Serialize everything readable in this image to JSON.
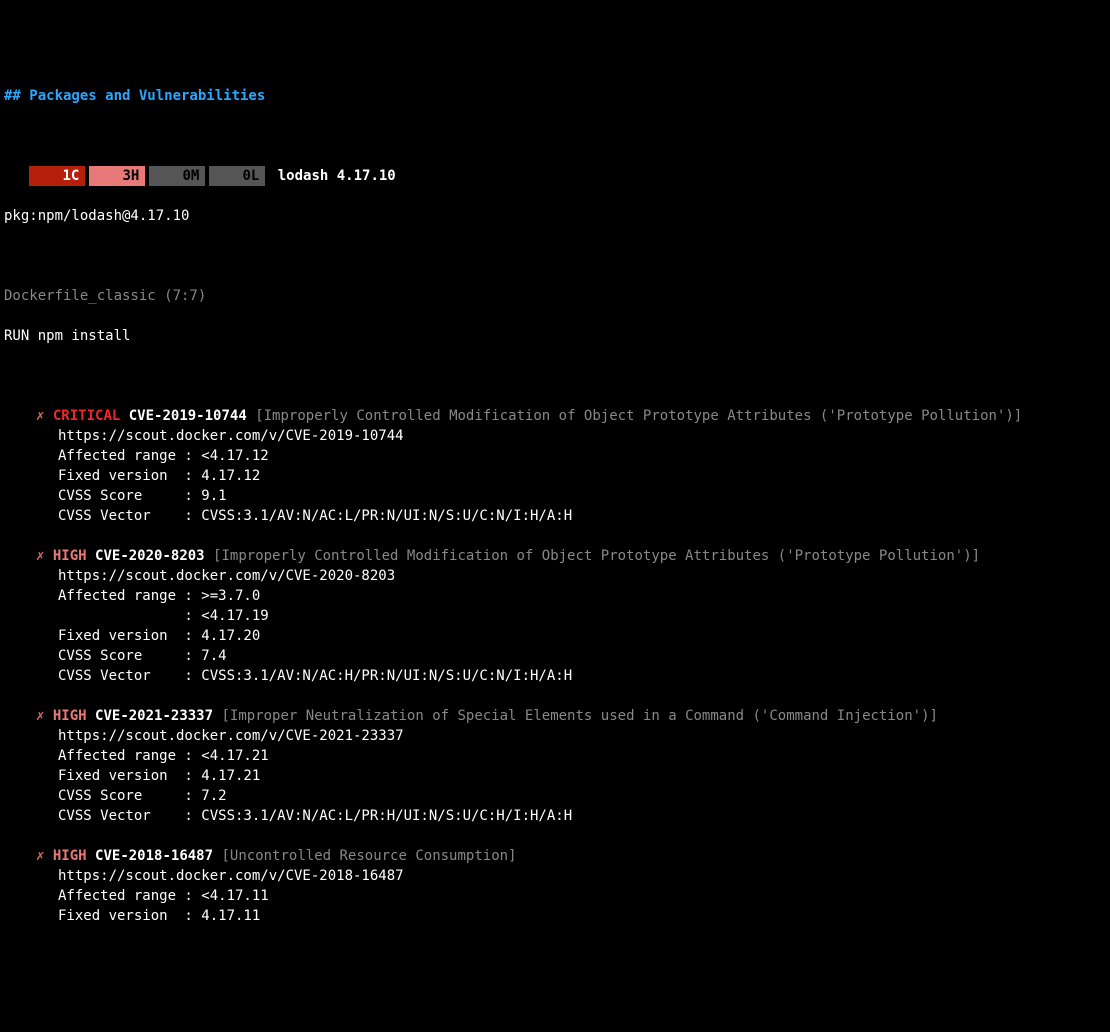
{
  "heading": "## Packages and Vulnerabilities",
  "badges": {
    "critical": "1C",
    "high": "3H",
    "medium": "0M",
    "low": "0L"
  },
  "package": {
    "name": "lodash 4.17.10",
    "purl": "pkg:npm/lodash@4.17.10"
  },
  "source": {
    "file": "Dockerfile_classic (7:7)",
    "line": "RUN npm install"
  },
  "marker": "✗",
  "sev_labels": {
    "critical": "CRITICAL",
    "high": "HIGH"
  },
  "vulns": [
    {
      "severity": "critical",
      "cve": "CVE-2019-10744",
      "desc": "[Improperly Controlled Modification of Object Prototype Attributes ('Prototype Pollution')]",
      "url": "https://scout.docker.com/v/CVE-2019-10744",
      "fields": [
        {
          "k": "Affected range",
          "v": "<4.17.12"
        },
        {
          "k": "Fixed version",
          "v": "4.17.12"
        },
        {
          "k": "CVSS Score",
          "v": "9.1"
        },
        {
          "k": "CVSS Vector",
          "v": "CVSS:3.1/AV:N/AC:L/PR:N/UI:N/S:U/C:N/I:H/A:H"
        }
      ]
    },
    {
      "severity": "high",
      "cve": "CVE-2020-8203",
      "desc": "[Improperly Controlled Modification of Object Prototype Attributes ('Prototype Pollution')]",
      "url": "https://scout.docker.com/v/CVE-2020-8203",
      "fields": [
        {
          "k": "Affected range",
          "v": ">=3.7.0"
        },
        {
          "k": "",
          "v": "<4.17.19"
        },
        {
          "k": "Fixed version",
          "v": "4.17.20"
        },
        {
          "k": "CVSS Score",
          "v": "7.4"
        },
        {
          "k": "CVSS Vector",
          "v": "CVSS:3.1/AV:N/AC:H/PR:N/UI:N/S:U/C:N/I:H/A:H"
        }
      ]
    },
    {
      "severity": "high",
      "cve": "CVE-2021-23337",
      "desc": "[Improper Neutralization of Special Elements used in a Command ('Command Injection')]",
      "url": "https://scout.docker.com/v/CVE-2021-23337",
      "fields": [
        {
          "k": "Affected range",
          "v": "<4.17.21"
        },
        {
          "k": "Fixed version",
          "v": "4.17.21"
        },
        {
          "k": "CVSS Score",
          "v": "7.2"
        },
        {
          "k": "CVSS Vector",
          "v": "CVSS:3.1/AV:N/AC:L/PR:H/UI:N/S:U/C:H/I:H/A:H"
        }
      ]
    },
    {
      "severity": "high",
      "cve": "CVE-2018-16487",
      "desc": "[Uncontrolled Resource Consumption]",
      "url": "https://scout.docker.com/v/CVE-2018-16487",
      "fields": [
        {
          "k": "Affected range",
          "v": "<4.17.11"
        },
        {
          "k": "Fixed version",
          "v": "4.17.11"
        }
      ]
    }
  ]
}
